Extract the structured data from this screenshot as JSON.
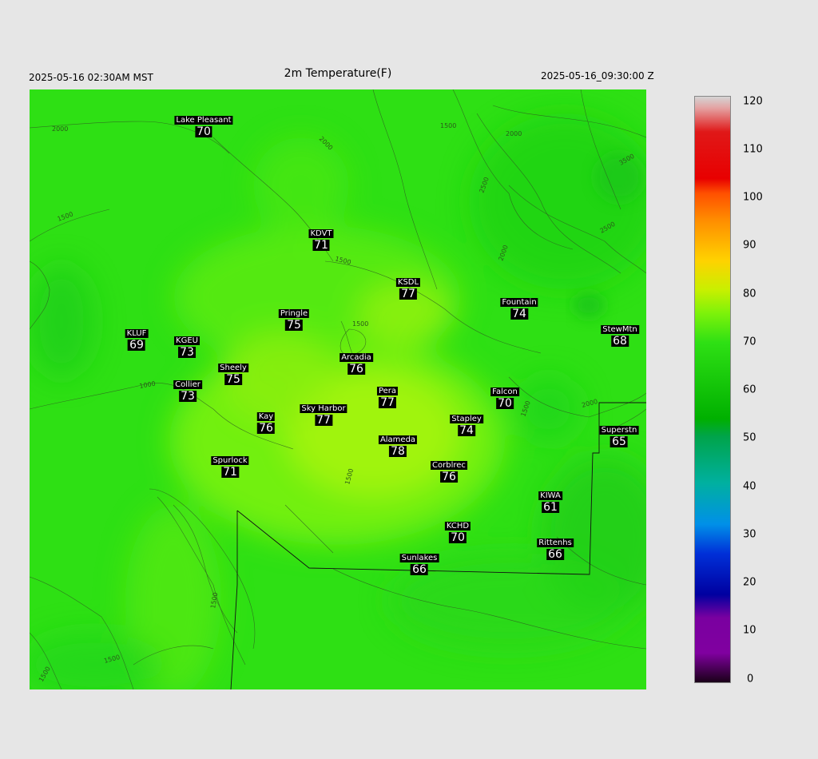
{
  "header": {
    "local_time": "2025-05-16 02:30AM MST",
    "title": "2m Temperature(F)",
    "utc_time": "2025-05-16_09:30:00 Z"
  },
  "stations": [
    {
      "name": "Lake Pleasant",
      "value": "70"
    },
    {
      "name": "KDVT",
      "value": "71"
    },
    {
      "name": "KSDL",
      "value": "77"
    },
    {
      "name": "Fountain",
      "value": "74"
    },
    {
      "name": "Pringle",
      "value": "75"
    },
    {
      "name": "KLUF",
      "value": "69"
    },
    {
      "name": "KGEU",
      "value": "73"
    },
    {
      "name": "StewMtn",
      "value": "68"
    },
    {
      "name": "Arcadia",
      "value": "76"
    },
    {
      "name": "Sheely",
      "value": "75"
    },
    {
      "name": "Collier",
      "value": "73"
    },
    {
      "name": "Pera",
      "value": "77"
    },
    {
      "name": "Falcon",
      "value": "70"
    },
    {
      "name": "Sky Harbor",
      "value": "77"
    },
    {
      "name": "Kay",
      "value": "76"
    },
    {
      "name": "Stapley",
      "value": "74"
    },
    {
      "name": "Superstn",
      "value": "65"
    },
    {
      "name": "Alameda",
      "value": "78"
    },
    {
      "name": "Spurlock",
      "value": "71"
    },
    {
      "name": "Corblrec",
      "value": "76"
    },
    {
      "name": "KIWA",
      "value": "61"
    },
    {
      "name": "KCHD",
      "value": "70"
    },
    {
      "name": "Rittenhs",
      "value": "66"
    },
    {
      "name": "Sunlakes",
      "value": "66"
    }
  ],
  "contour_labels": [
    "2000",
    "2000",
    "1500",
    "2000",
    "2500",
    "2500",
    "2000",
    "3500",
    "1500",
    "1500",
    "1500",
    "1000",
    "2000",
    "1500",
    "1500",
    "1500",
    "1500",
    "1500"
  ],
  "colorbar": {
    "ticks": [
      "120",
      "110",
      "100",
      "90",
      "80",
      "70",
      "60",
      "50",
      "40",
      "30",
      "20",
      "10",
      "0"
    ]
  }
}
